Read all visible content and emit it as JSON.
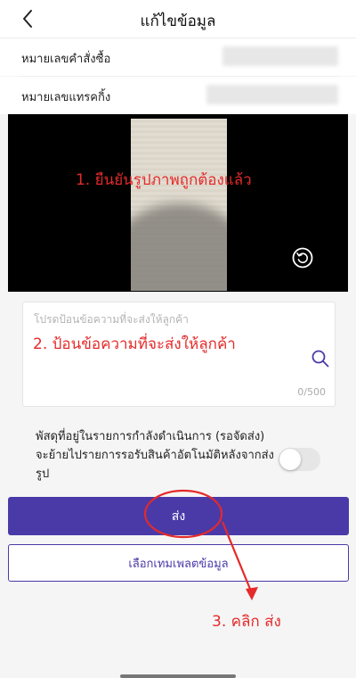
{
  "header": {
    "title": "แก้ไขข้อมูล"
  },
  "order": {
    "order_number_label": "หมายเลขคำสั่งซื้อ",
    "tracking_number_label": "หมายเลขแทรคกิ้ง"
  },
  "annotations": {
    "step1": "1. ยืนยันรูปภาพถูกต้องแล้ว",
    "step2": "2. ป้อนข้อความที่จะส่งให้ลูกค้า",
    "step3": "3. คลิก ส่ง"
  },
  "message": {
    "placeholder": "โปรดป้อนข้อความที่จะส่งให้ลูกค้า",
    "value": "",
    "counter": "0/500"
  },
  "auto_move": {
    "text": "พัสดุที่อยู่ในรายการกำลังดำเนินการ (รอจัดส่ง) จะย้ายไปรายการรอรับสินค้าอัตโนมัติหลังจากส่งรูป",
    "enabled": false
  },
  "actions": {
    "send_label": "ส่ง",
    "template_label": "เลือกเทมเพลตข้อมูล"
  },
  "colors": {
    "primary": "#4a3aa8",
    "annotation": "#e52a2a"
  },
  "icons": {
    "back": "chevron-left-icon",
    "rotate": "rotate-icon",
    "search": "search-icon"
  }
}
